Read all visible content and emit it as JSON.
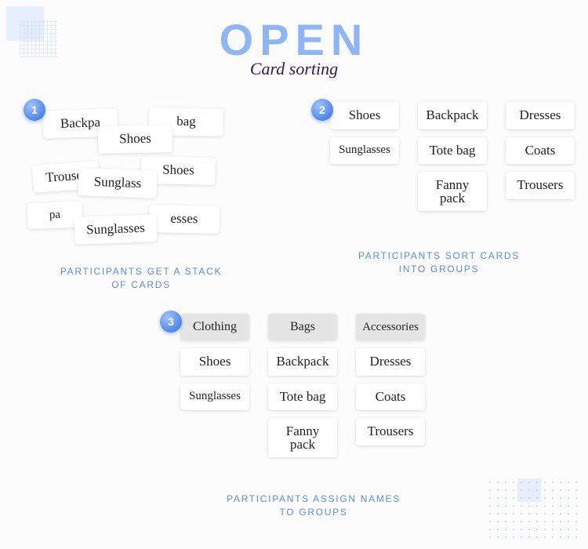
{
  "title": {
    "line1": "OPEN",
    "line2": "Card sorting"
  },
  "steps": {
    "one": {
      "number": "1",
      "caption_l1": "PARTICIPANTS GET A STACK",
      "caption_l2": "OF CARDS",
      "cards": {
        "c1": "Backpa",
        "c2": "bag",
        "c3": "Shoes",
        "c4": "Shoes",
        "c5": "Trouser",
        "c6": "Sunglass",
        "c7": "pa",
        "c8": "esses",
        "c9": "Sunglasses"
      }
    },
    "two": {
      "number": "2",
      "caption_l1": "PARTICIPANTS SORT CARDS",
      "caption_l2": "INTO GROUPS",
      "columns": [
        [
          "Shoes",
          "Sunglasses"
        ],
        [
          "Backpack",
          "Tote bag",
          "Fanny pack"
        ],
        [
          "Dresses",
          "Coats",
          "Trousers"
        ]
      ]
    },
    "three": {
      "number": "3",
      "caption_l1": "PARTICIPANTS ASSIGN NAMES",
      "caption_l2": "TO GROUPS",
      "columns": [
        {
          "name": "Clothing",
          "cards": [
            "Shoes",
            "Sunglasses"
          ]
        },
        {
          "name": "Bags",
          "cards": [
            "Backpack",
            "Tote bag",
            "Fanny pack"
          ]
        },
        {
          "name": "Accessories",
          "cards": [
            "Dresses",
            "Coats",
            "Trousers"
          ]
        }
      ]
    }
  }
}
